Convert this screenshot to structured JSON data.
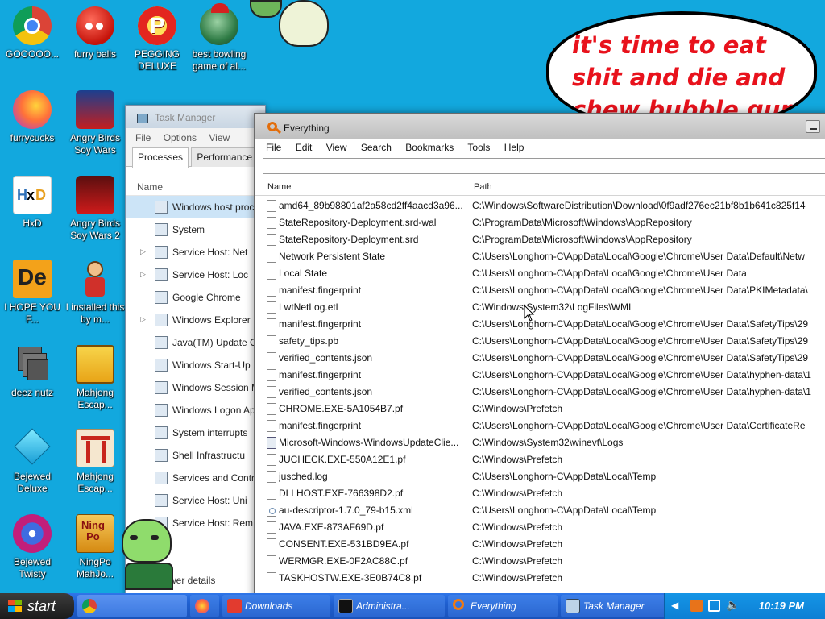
{
  "desktop_icons": [
    {
      "label": "GOOOOO...",
      "icon": "chrome-icon"
    },
    {
      "label": "furry balls",
      "icon": "red-ball-icon"
    },
    {
      "label": "PEGGING DELUXE",
      "icon": "pegging-icon"
    },
    {
      "label": "best bowling game of al...",
      "icon": "bowling-icon"
    },
    {
      "label": "furrycucks",
      "icon": "firefox-icon"
    },
    {
      "label": "Angry Birds Soy Wars",
      "icon": "angry-birds-icon"
    },
    {
      "label": "HxD",
      "icon": "hxd-icon"
    },
    {
      "label": "Angry Birds Soy Wars 2",
      "icon": "angry-birds-2-icon"
    },
    {
      "label": "I HOPE YOU F...",
      "icon": "de-icon"
    },
    {
      "label": "I installed this by m...",
      "icon": "character-icon"
    },
    {
      "label": "deez nutz",
      "icon": "windows-stack-icon"
    },
    {
      "label": "Mahjong Escap...",
      "icon": "mahjong-icon"
    },
    {
      "label": "Bejewed Deluxe",
      "icon": "gem-icon"
    },
    {
      "label": "Mahjong Escap...",
      "icon": "torii-icon"
    },
    {
      "label": "Bejewed Twisty",
      "icon": "twist-gem-icon"
    },
    {
      "label": "NingPo MahJo...",
      "icon": "ningpo-icon"
    }
  ],
  "bubble_text": "it's time to eat shit and die and chew bubble gum",
  "task_manager": {
    "title": "Task Manager",
    "menu": [
      "File",
      "Options",
      "View"
    ],
    "tabs": [
      "Processes",
      "Performance"
    ],
    "column": "Name",
    "rows": [
      {
        "label": "Windows host proc",
        "expand": "",
        "selected": true
      },
      {
        "label": "System",
        "expand": ""
      },
      {
        "label": "Service Host: Net",
        "expand": "▷"
      },
      {
        "label": "Service Host: Loc",
        "expand": "▷"
      },
      {
        "label": "Google Chrome",
        "expand": ""
      },
      {
        "label": "Windows Explorer",
        "expand": "▷"
      },
      {
        "label": "Java(TM) Update C",
        "expand": ""
      },
      {
        "label": "Windows Start-Up",
        "expand": ""
      },
      {
        "label": "Windows Session M",
        "expand": ""
      },
      {
        "label": "Windows Logon Ap",
        "expand": ""
      },
      {
        "label": "System interrupts",
        "expand": ""
      },
      {
        "label": "Shell Infrastructu",
        "expand": ""
      },
      {
        "label": "Services and Contr",
        "expand": ""
      },
      {
        "label": "Service Host: Uni",
        "expand": ""
      },
      {
        "label": "Service Host: Rem",
        "expand": ""
      }
    ],
    "footer": "Fewer details"
  },
  "everything": {
    "title": "Everything",
    "menu": [
      "File",
      "Edit",
      "View",
      "Search",
      "Bookmarks",
      "Tools",
      "Help"
    ],
    "search_value": "",
    "columns": {
      "name": "Name",
      "path": "Path"
    },
    "rows": [
      {
        "name": "amd64_89b98801af2a58cd2ff4aacd3a96...",
        "path": "C:\\Windows\\SoftwareDistribution\\Download\\0f9adf276ec21bf8b1b641c825f14",
        "type": "file"
      },
      {
        "name": "StateRepository-Deployment.srd-wal",
        "path": "C:\\ProgramData\\Microsoft\\Windows\\AppRepository",
        "type": "file"
      },
      {
        "name": "StateRepository-Deployment.srd",
        "path": "C:\\ProgramData\\Microsoft\\Windows\\AppRepository",
        "type": "file"
      },
      {
        "name": "Network Persistent State",
        "path": "C:\\Users\\Longhorn-C\\AppData\\Local\\Google\\Chrome\\User Data\\Default\\Netw",
        "type": "file"
      },
      {
        "name": "Local State",
        "path": "C:\\Users\\Longhorn-C\\AppData\\Local\\Google\\Chrome\\User Data",
        "type": "file"
      },
      {
        "name": "manifest.fingerprint",
        "path": "C:\\Users\\Longhorn-C\\AppData\\Local\\Google\\Chrome\\User Data\\PKIMetadata\\",
        "type": "file"
      },
      {
        "name": "LwtNetLog.etl",
        "path": "C:\\Windows\\System32\\LogFiles\\WMI",
        "type": "file"
      },
      {
        "name": "manifest.fingerprint",
        "path": "C:\\Users\\Longhorn-C\\AppData\\Local\\Google\\Chrome\\User Data\\SafetyTips\\29",
        "type": "file"
      },
      {
        "name": "safety_tips.pb",
        "path": "C:\\Users\\Longhorn-C\\AppData\\Local\\Google\\Chrome\\User Data\\SafetyTips\\29",
        "type": "file"
      },
      {
        "name": "verified_contents.json",
        "path": "C:\\Users\\Longhorn-C\\AppData\\Local\\Google\\Chrome\\User Data\\SafetyTips\\29",
        "type": "file"
      },
      {
        "name": "manifest.fingerprint",
        "path": "C:\\Users\\Longhorn-C\\AppData\\Local\\Google\\Chrome\\User Data\\hyphen-data\\1",
        "type": "file"
      },
      {
        "name": "verified_contents.json",
        "path": "C:\\Users\\Longhorn-C\\AppData\\Local\\Google\\Chrome\\User Data\\hyphen-data\\1",
        "type": "file"
      },
      {
        "name": "CHROME.EXE-5A1054B7.pf",
        "path": "C:\\Windows\\Prefetch",
        "type": "file"
      },
      {
        "name": "manifest.fingerprint",
        "path": "C:\\Users\\Longhorn-C\\AppData\\Local\\Google\\Chrome\\User Data\\CertificateRe",
        "type": "file"
      },
      {
        "name": "Microsoft-Windows-WindowsUpdateClie...",
        "path": "C:\\Windows\\System32\\winevt\\Logs",
        "type": "evt"
      },
      {
        "name": "JUCHECK.EXE-550A12E1.pf",
        "path": "C:\\Windows\\Prefetch",
        "type": "file"
      },
      {
        "name": "jusched.log",
        "path": "C:\\Users\\Longhorn-C\\AppData\\Local\\Temp",
        "type": "file"
      },
      {
        "name": "DLLHOST.EXE-766398D2.pf",
        "path": "C:\\Windows\\Prefetch",
        "type": "file"
      },
      {
        "name": "au-descriptor-1.7.0_79-b15.xml",
        "path": "C:\\Users\\Longhorn-C\\AppData\\Local\\Temp",
        "type": "xml"
      },
      {
        "name": "JAVA.EXE-873AF69D.pf",
        "path": "C:\\Windows\\Prefetch",
        "type": "file"
      },
      {
        "name": "CONSENT.EXE-531BD9EA.pf",
        "path": "C:\\Windows\\Prefetch",
        "type": "file"
      },
      {
        "name": "WERMGR.EXE-0F2AC88C.pf",
        "path": "C:\\Windows\\Prefetch",
        "type": "file"
      },
      {
        "name": "TASKHOSTW.EXE-3E0B74C8.pf",
        "path": "C:\\Windows\\Prefetch",
        "type": "file"
      }
    ]
  },
  "taskbar": {
    "start_label": "start",
    "items": [
      {
        "label": "",
        "icon": "chrome-icon"
      },
      {
        "label": "",
        "icon": "firefox-icon"
      },
      {
        "label": "Downloads",
        "icon": "folder-icon"
      },
      {
        "label": "Administra...",
        "icon": "cmd-icon"
      },
      {
        "label": "Everything",
        "icon": "everything-icon"
      },
      {
        "label": "Task Manager",
        "icon": "taskmgr-icon"
      }
    ],
    "clock": "10:19 PM"
  },
  "colors": {
    "desktop": "#12a8de",
    "bubble_text": "#e8121c",
    "selection": "#cce4f7"
  }
}
